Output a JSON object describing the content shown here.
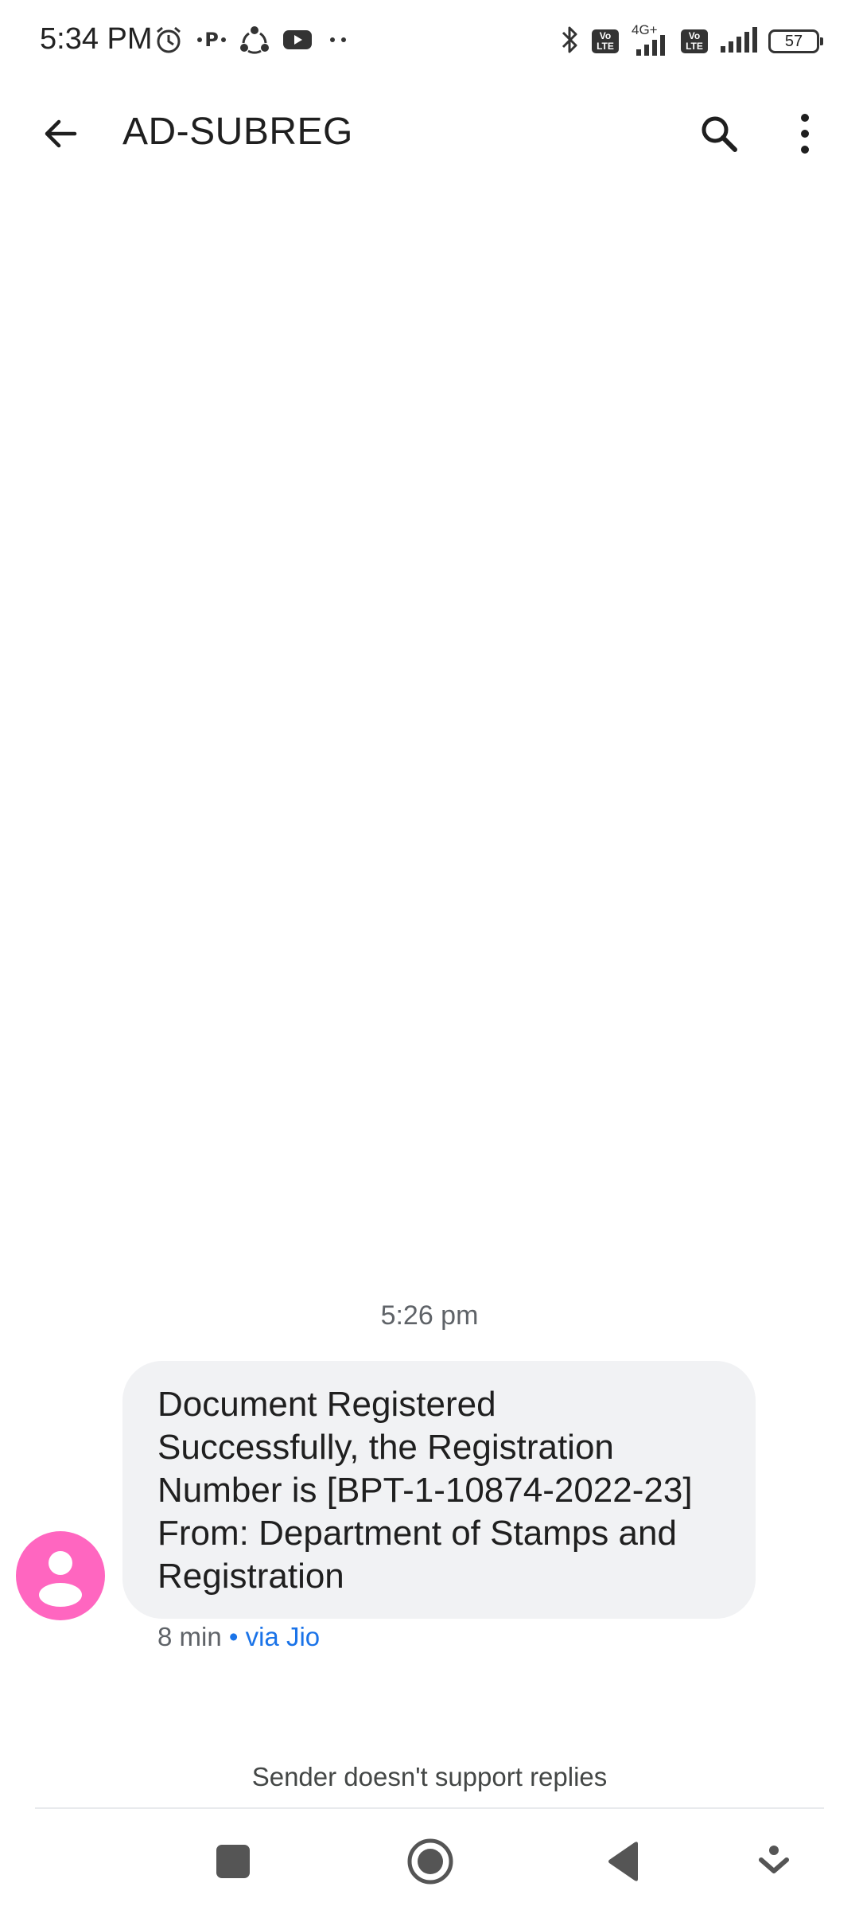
{
  "status_bar": {
    "time": "5:34 PM",
    "network_label": "4G+",
    "volte_label": "Vo LTE",
    "battery": "57",
    "icons_left": [
      "alarm-icon",
      "paytm-icon",
      "share-icon",
      "youtube-icon",
      "more-dots-icon"
    ],
    "icons_right": [
      "bluetooth-icon",
      "volte-icon",
      "signal-icon",
      "volte-icon",
      "signal-icon",
      "battery-icon"
    ]
  },
  "app_bar": {
    "title": "AD-SUBREG",
    "back_icon": "arrow-back-icon",
    "search_icon": "search-icon",
    "more_icon": "more-vert-icon"
  },
  "conversation": {
    "timestamp": "5:26 pm",
    "message": {
      "lines": [
        "Document Registered",
        "Successfully, the Registration",
        "Number is [BPT-1-10874-2022-23]",
        "From: Department of Stamps and",
        "Registration"
      ],
      "age": "8 min",
      "via": "• via Jio"
    },
    "avatar_color": "#ff66c0",
    "notice": "Sender doesn't support replies"
  },
  "nav_bar": {
    "items": [
      "recents-square-icon",
      "home-circle-icon",
      "back-triangle-icon",
      "assistant-down-icon"
    ]
  },
  "colors": {
    "bubble": "#f1f2f4",
    "link": "#1a73e8",
    "secondary_text": "#5f6368"
  }
}
